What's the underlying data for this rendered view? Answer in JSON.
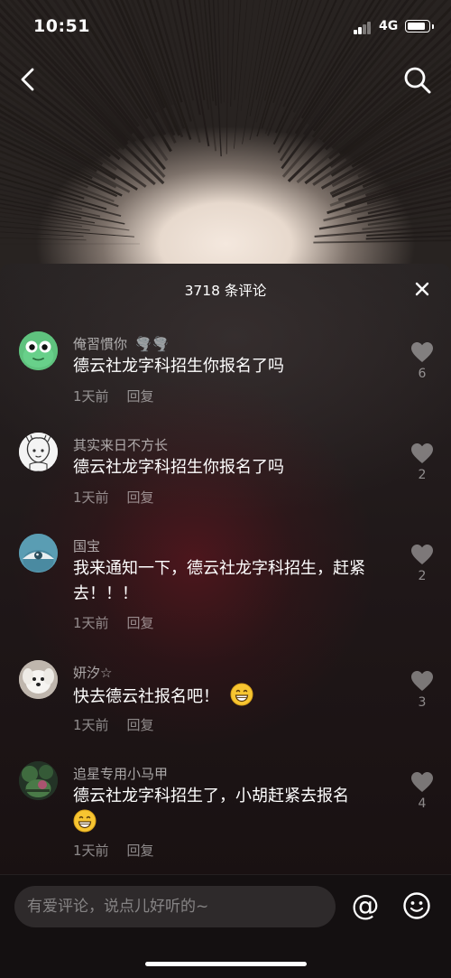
{
  "status_bar": {
    "time": "10:51",
    "network": "4G"
  },
  "icons": {
    "back": "chevron-left-icon",
    "search": "search-icon",
    "close": "close-icon",
    "like": "heart-icon",
    "at": "at-icon",
    "emoji": "smiley-icon"
  },
  "sheet": {
    "title": "3718 条评论"
  },
  "comments": [
    {
      "user": "俺習慣你",
      "user_badges": "🌪️🌪️",
      "text": "德云社龙字科招生你报名了吗",
      "time": "1天前",
      "reply_label": "回复",
      "likes": "6"
    },
    {
      "user": "其实来日不方长",
      "text": "德云社龙字科招生你报名了吗",
      "time": "1天前",
      "reply_label": "回复",
      "likes": "2"
    },
    {
      "user": "国宝",
      "text": "我来通知一下，德云社龙字科招生，赶紧去！！！",
      "time": "1天前",
      "reply_label": "回复",
      "likes": "2"
    },
    {
      "user": "妍汐☆",
      "text": "快去德云社报名吧！",
      "time": "1天前",
      "reply_label": "回复",
      "likes": "3"
    },
    {
      "user": "追星专用小马甲",
      "text": "德云社龙字科招生了，小胡赶紧去报名",
      "time": "1天前",
      "reply_label": "回复",
      "likes": "4"
    }
  ],
  "input": {
    "placeholder": "有爱评论，说点儿好听的~",
    "value": "",
    "at_label": "@"
  },
  "colors": {
    "sheet_bg": "#1f1819",
    "input_bg": "#2e2a2b",
    "accent_text": "#ffffff"
  }
}
